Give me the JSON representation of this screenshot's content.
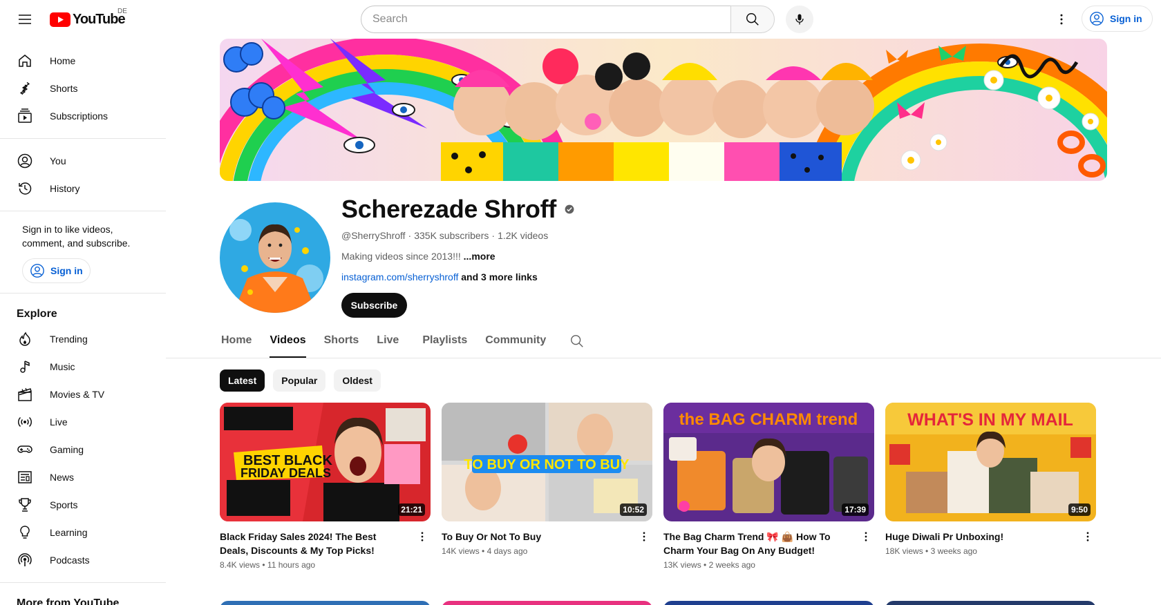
{
  "masthead": {
    "logo_text": "YouTube",
    "country_code": "DE",
    "search_placeholder": "Search",
    "signin_label": "Sign in"
  },
  "sidebar": {
    "main": [
      {
        "label": "Home",
        "icon": "home-icon"
      },
      {
        "label": "Shorts",
        "icon": "shorts-icon"
      },
      {
        "label": "Subscriptions",
        "icon": "subscriptions-icon"
      }
    ],
    "you": [
      {
        "label": "You",
        "icon": "user-icon"
      },
      {
        "label": "History",
        "icon": "history-icon"
      }
    ],
    "signin_prompt": "Sign in to like videos, comment, and subscribe.",
    "signin_label": "Sign in",
    "explore_heading": "Explore",
    "explore": [
      {
        "label": "Trending",
        "icon": "trending-icon"
      },
      {
        "label": "Music",
        "icon": "music-icon"
      },
      {
        "label": "Movies & TV",
        "icon": "movies-icon"
      },
      {
        "label": "Live",
        "icon": "live-icon"
      },
      {
        "label": "Gaming",
        "icon": "gaming-icon"
      },
      {
        "label": "News",
        "icon": "news-icon"
      },
      {
        "label": "Sports",
        "icon": "sports-icon"
      },
      {
        "label": "Learning",
        "icon": "learning-icon"
      },
      {
        "label": "Podcasts",
        "icon": "podcasts-icon"
      }
    ],
    "more_heading": "More from YouTube"
  },
  "channel": {
    "name": "Scherezade Shroff",
    "handle": "@SherryShroff",
    "subscribers": "335K subscribers",
    "videos_count": "1.2K videos",
    "separator": "·",
    "description": "Making videos since 2013!!!",
    "description_more": "...more",
    "link": "instagram.com/sherryshroff",
    "more_links": "and 3 more links",
    "subscribe_label": "Subscribe"
  },
  "tabs": [
    {
      "label": "Home",
      "active": false
    },
    {
      "label": "Videos",
      "active": true
    },
    {
      "label": "Shorts",
      "active": false
    },
    {
      "label": "Live",
      "active": false
    },
    {
      "label": "Playlists",
      "active": false
    },
    {
      "label": "Community",
      "active": false
    }
  ],
  "chips": [
    {
      "label": "Latest",
      "active": true
    },
    {
      "label": "Popular",
      "active": false
    },
    {
      "label": "Oldest",
      "active": false
    }
  ],
  "videos": [
    {
      "title": "Black Friday Sales 2024! The Best Deals, Discounts & My Top Picks!",
      "views": "8.4K views",
      "age": "11 hours ago",
      "duration": "21:21",
      "thumb_text": [
        "BEST BLACK",
        "FRIDAY DEALS"
      ],
      "thumb_bg": "#d7262c"
    },
    {
      "title": "To Buy Or Not To Buy",
      "views": "14K views",
      "age": "4 days ago",
      "duration": "10:52",
      "thumb_text": [
        "TO BUY OR NOT TO BUY"
      ],
      "thumb_bg": "#c9c9c9"
    },
    {
      "title": "The Bag Charm Trend 🎀 👜 How To Charm Your Bag On Any Budget!",
      "views": "13K views",
      "age": "2 weeks ago",
      "duration": "17:39",
      "thumb_text": [
        "the BAG CHARM trend"
      ],
      "thumb_bg": "#5b2a8c"
    },
    {
      "title": "Huge Diwali Pr Unboxing!",
      "views": "18K views",
      "age": "3 weeks ago",
      "duration": "9:50",
      "thumb_text": [
        "WHAT'S IN MY MAIL"
      ],
      "thumb_bg": "#f2b21d"
    }
  ],
  "colors": {
    "brand_red": "#ff0000",
    "link_blue": "#065fd4",
    "text_primary": "#0f0f0f",
    "text_secondary": "#606060"
  }
}
